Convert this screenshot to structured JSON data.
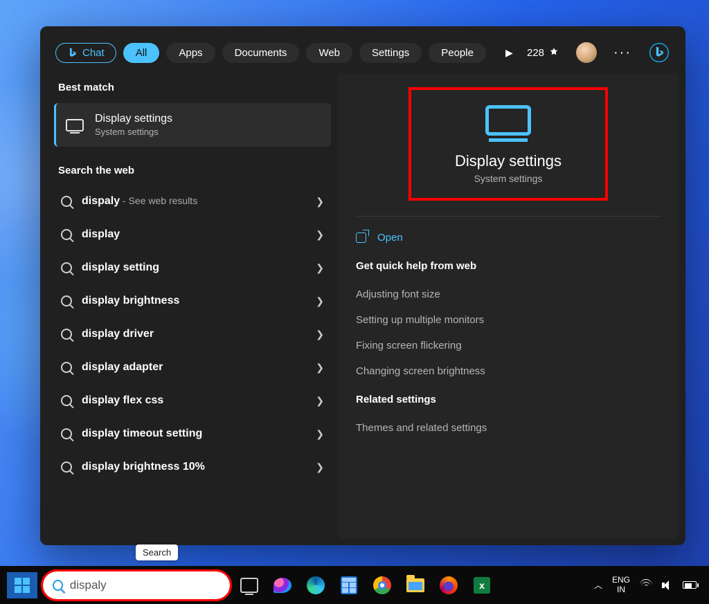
{
  "header": {
    "chat": "Chat",
    "filters": [
      "All",
      "Apps",
      "Documents",
      "Web",
      "Settings",
      "People"
    ],
    "active_filter": "All",
    "points": "228"
  },
  "left": {
    "best_match_hdr": "Best match",
    "best_match": {
      "title": "Display settings",
      "subtitle": "System settings"
    },
    "web_hdr": "Search the web",
    "suggestions": [
      {
        "term": "dispaly",
        "tail": " - See web results"
      },
      {
        "term": "display",
        "tail": ""
      },
      {
        "term": "display setting",
        "tail": ""
      },
      {
        "term": "display brightness",
        "tail": ""
      },
      {
        "term": "display driver",
        "tail": ""
      },
      {
        "term": "display adapter",
        "tail": ""
      },
      {
        "term": "display flex css",
        "tail": ""
      },
      {
        "term": "display timeout setting",
        "tail": ""
      },
      {
        "term": "display brightness 10%",
        "tail": ""
      }
    ]
  },
  "right": {
    "title": "Display settings",
    "subtitle": "System settings",
    "open_label": "Open",
    "help_hdr": "Get quick help from web",
    "help_links": [
      "Adjusting font size",
      "Setting up multiple monitors",
      "Fixing screen flickering",
      "Changing screen brightness"
    ],
    "related_hdr": "Related settings",
    "related_links": [
      "Themes and related settings"
    ]
  },
  "tooltip": "Search",
  "taskbar": {
    "search_value": "dispaly",
    "lang_top": "ENG",
    "lang_bottom": "IN"
  }
}
